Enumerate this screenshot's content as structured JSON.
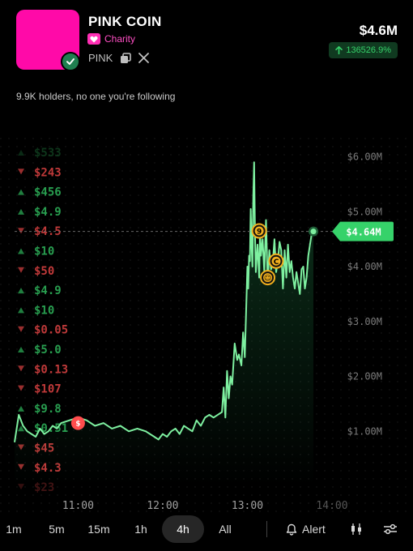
{
  "token": {
    "name": "PINK COIN",
    "tag": "Charity",
    "ticker": "PINK",
    "avatar_color": "#ff0aa8"
  },
  "stats": {
    "market_cap": "$4.6M",
    "change": "136526.9%",
    "change_direction": "up",
    "holders_text": "9.9K holders, no one you're following"
  },
  "colors": {
    "up": "#36d26a",
    "down": "#ff4d4d",
    "line": "#7ef0a0",
    "accent_pink": "#ff2fb5"
  },
  "timeframes": [
    "1m",
    "5m",
    "15m",
    "1h",
    "4h",
    "All"
  ],
  "active_timeframe": "4h",
  "toolbar": {
    "alert_label": "Alert",
    "candles_icon": "candlestick-icon",
    "settings_icon": "sliders-icon"
  },
  "trade_feed": [
    {
      "side": "buy",
      "amount": "$533"
    },
    {
      "side": "sell",
      "amount": "$243"
    },
    {
      "side": "buy",
      "amount": "$456"
    },
    {
      "side": "buy",
      "amount": "$4.9"
    },
    {
      "side": "sell",
      "amount": "$4.5"
    },
    {
      "side": "buy",
      "amount": "$10"
    },
    {
      "side": "sell",
      "amount": "$50"
    },
    {
      "side": "buy",
      "amount": "$4.9"
    },
    {
      "side": "buy",
      "amount": "$10"
    },
    {
      "side": "sell",
      "amount": "$0.05"
    },
    {
      "side": "buy",
      "amount": "$5.0"
    },
    {
      "side": "sell",
      "amount": "$0.13"
    },
    {
      "side": "sell",
      "amount": "$107"
    },
    {
      "side": "buy",
      "amount": "$9.8"
    },
    {
      "side": "buy",
      "amount": "$0.51"
    },
    {
      "side": "sell",
      "amount": "$45"
    },
    {
      "side": "sell",
      "amount": "$4.3"
    },
    {
      "side": "sell",
      "amount": "$23"
    }
  ],
  "chart_data": {
    "type": "line",
    "x_ticks": [
      "11:00",
      "12:00",
      "13:00",
      "14:00"
    ],
    "y_ticks": [
      "$1.00M",
      "$2.00M",
      "$3.00M",
      "$4.00M",
      "$5.00M",
      "$6.00M"
    ],
    "ylim": [
      0,
      6.2
    ],
    "xlim": [
      10.25,
      14.0
    ],
    "ylabel_unit": "$M",
    "current_label": "$4.64M",
    "current_value": 4.64,
    "series": [
      {
        "x": [
          10.25,
          10.3,
          10.35,
          10.4,
          10.45,
          10.5,
          10.55,
          10.6,
          10.65,
          10.7,
          10.75,
          10.8,
          10.9,
          11.0,
          11.1,
          11.2,
          11.3,
          11.4,
          11.5,
          11.6,
          11.7,
          11.8,
          11.9,
          11.95,
          12.0,
          12.05,
          12.1,
          12.15,
          12.2,
          12.25,
          12.3,
          12.35,
          12.4,
          12.45,
          12.5,
          12.55,
          12.6,
          12.65,
          12.7,
          12.72,
          12.74,
          12.76,
          12.78,
          12.8,
          12.82,
          12.85,
          12.88,
          12.9,
          12.93,
          12.95,
          12.97,
          13.0,
          13.01,
          13.02,
          13.03,
          13.04,
          13.05,
          13.06,
          13.07,
          13.08,
          13.09,
          13.1,
          13.12,
          13.14,
          13.15,
          13.16,
          13.18,
          13.2,
          13.22,
          13.24,
          13.26,
          13.28,
          13.3,
          13.32,
          13.34,
          13.36,
          13.38,
          13.4,
          13.42,
          13.44,
          13.46,
          13.48,
          13.5,
          13.52,
          13.54,
          13.56,
          13.58,
          13.6,
          13.62,
          13.64,
          13.66,
          13.68,
          13.7,
          13.72,
          13.74,
          13.76,
          13.78
        ],
        "y": [
          0.8,
          1.3,
          1.1,
          1.0,
          0.95,
          0.9,
          1.05,
          0.95,
          1.0,
          1.1,
          1.05,
          1.15,
          1.2,
          1.25,
          1.2,
          1.1,
          1.15,
          1.05,
          1.1,
          1.0,
          1.05,
          1.0,
          0.9,
          0.85,
          0.95,
          0.9,
          1.0,
          1.05,
          0.95,
          1.1,
          1.05,
          1.0,
          1.2,
          1.1,
          1.25,
          1.3,
          1.25,
          1.3,
          1.35,
          1.8,
          1.25,
          2.1,
          1.6,
          2.0,
          1.85,
          2.6,
          2.3,
          2.4,
          2.2,
          2.8,
          2.35,
          4.0,
          3.6,
          4.2,
          4.1,
          5.05,
          4.4,
          4.0,
          5.3,
          5.9,
          4.6,
          3.9,
          4.4,
          3.8,
          4.7,
          4.2,
          4.5,
          3.9,
          4.85,
          3.7,
          4.3,
          3.95,
          4.05,
          4.5,
          3.9,
          4.1,
          4.45,
          4.3,
          3.6,
          4.3,
          3.8,
          4.4,
          3.9,
          4.1,
          3.8,
          3.6,
          3.9,
          3.7,
          3.5,
          3.95,
          4.0,
          3.6,
          3.8,
          4.2,
          4.4,
          4.6,
          4.64
        ]
      }
    ],
    "markers": [
      {
        "label": "$",
        "x": 11.0,
        "y": 1.15,
        "color": "#ff4d4d"
      },
      {
        "label": "9",
        "x": 13.14,
        "y": 4.65,
        "color": "#f2b01e"
      },
      {
        "label": "C",
        "x": 13.34,
        "y": 4.1,
        "color": "#f2b01e"
      },
      {
        "label": "☺",
        "x": 13.24,
        "y": 3.8,
        "color": "#f2b01e"
      }
    ],
    "grid": "dotted"
  }
}
